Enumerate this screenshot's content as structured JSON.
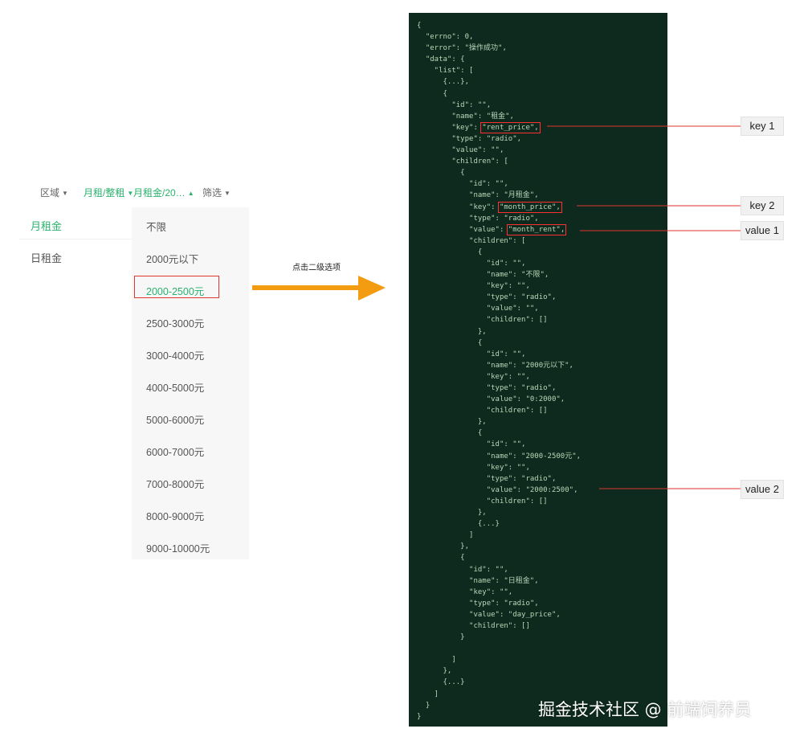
{
  "filter_bar": {
    "tabs": [
      {
        "label": "区域",
        "active": false
      },
      {
        "label": "月租/整租",
        "active": true
      },
      {
        "label": "月租金/20…",
        "active": true
      },
      {
        "label": "筛选",
        "active": false
      }
    ]
  },
  "dropdown": {
    "primary": [
      "月租金",
      "日租金"
    ],
    "primary_active": "月租金",
    "secondary": [
      "不限",
      "2000元以下",
      "2000-2500元",
      "2500-3000元",
      "3000-4000元",
      "4000-5000元",
      "5000-6000元",
      "6000-7000元",
      "7000-8000元",
      "8000-9000元",
      "9000-10000元"
    ],
    "secondary_selected": "2000-2500元"
  },
  "caption": "点击二级选项",
  "code_lines": [
    "{",
    "  \"errno\": 0,",
    "  \"error\": \"操作成功\",",
    "  \"data\": {",
    "    \"list\": [",
    "      {...},",
    "      {",
    "        \"id\": \"\",",
    "        \"name\": \"租金\",",
    "        \"key\": \"rent_price\",",
    "        \"type\": \"radio\",",
    "        \"value\": \"\",",
    "        \"children\": [",
    "          {",
    "            \"id\": \"\",",
    "            \"name\": \"月租金\",",
    "            \"key\": \"month_price\",",
    "            \"type\": \"radio\",",
    "            \"value\": \"month_rent\",",
    "            \"children\": [",
    "              {",
    "                \"id\": \"\",",
    "                \"name\": \"不限\",",
    "                \"key\": \"\",",
    "                \"type\": \"radio\",",
    "                \"value\": \"\",",
    "                \"children\": []",
    "              },",
    "              {",
    "                \"id\": \"\",",
    "                \"name\": \"2000元以下\",",
    "                \"key\": \"\",",
    "                \"type\": \"radio\",",
    "                \"value\": \"0:2000\",",
    "                \"children\": []",
    "              },",
    "              {",
    "                \"id\": \"\",",
    "                \"name\": \"2000-2500元\",",
    "                \"key\": \"\",",
    "                \"type\": \"radio\",",
    "                \"value\": \"2000:2500\",",
    "                \"children\": []",
    "              },",
    "              {...}",
    "            ]",
    "          },",
    "          {",
    "            \"id\": \"\",",
    "            \"name\": \"日租金\",",
    "            \"key\": \"\",",
    "            \"type\": \"radio\",",
    "            \"value\": \"day_price\",",
    "            \"children\": []",
    "          }",
    "",
    "        ]",
    "      },",
    "      {...}",
    "    ]",
    "  }",
    "}"
  ],
  "highlights": [
    {
      "line": 9,
      "text": "\"rent_price\","
    },
    {
      "line": 16,
      "text": "\"month_price\","
    },
    {
      "line": 18,
      "text": "\"month_rent\","
    },
    {
      "line": 40,
      "text": "\"2000:2500\","
    }
  ],
  "callouts": {
    "key1": "key 1",
    "key2": "key 2",
    "value1": "value 1",
    "value2": "value 2"
  },
  "watermark": "掘金技术社区 @ 前端饲养员",
  "colors": {
    "accent_green": "#2ab26e",
    "highlight_red": "#e0362c",
    "arrow_orange": "#f39c12",
    "code_bg": "#0e2a1e"
  }
}
